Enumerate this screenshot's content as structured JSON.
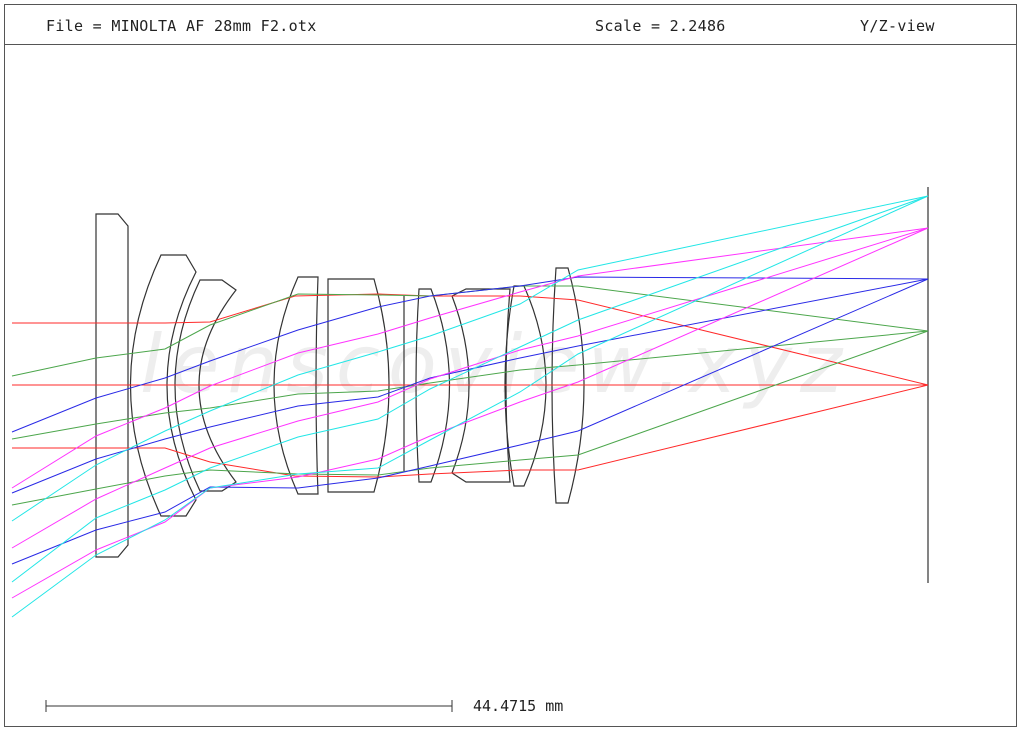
{
  "header": {
    "file": "File = MINOLTA AF 28mm F2.otx",
    "scale": "Scale = 2.2486",
    "view": "Y/Z-view"
  },
  "watermark": "lenscoview.xyz",
  "scale_bar": {
    "label": "44.4715 mm"
  },
  "ray_colors": {
    "red": "#ff2a2a",
    "green": "#4ca64c",
    "blue": "#2a2ae6",
    "magenta": "#ff33ff",
    "cyan": "#22e6e6"
  },
  "lens_color": "#333333"
}
